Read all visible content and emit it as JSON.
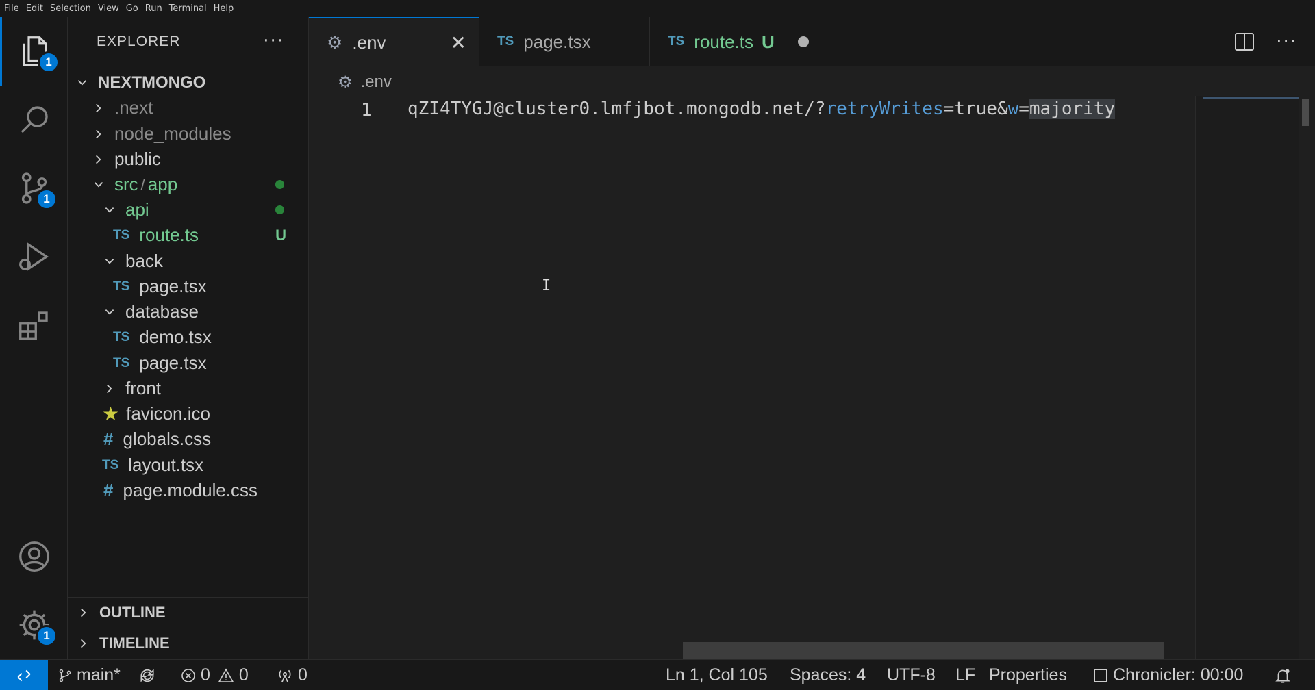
{
  "menu": [
    "File",
    "Edit",
    "Selection",
    "View",
    "Go",
    "Run",
    "Terminal",
    "Help"
  ],
  "activity": {
    "explorer_badge": "1",
    "scm_badge": "1",
    "settings_badge": "1"
  },
  "sidebar": {
    "title": "EXPLORER",
    "more": "···",
    "root": "NEXTMONGO",
    "tree": {
      "next": ".next",
      "node_modules": "node_modules",
      "public": "public",
      "src": "src",
      "sep": "/",
      "app": "app",
      "api": "api",
      "route": "route.ts",
      "route_status": "U",
      "back": "back",
      "back_page": "page.tsx",
      "database": "database",
      "demo": "demo.tsx",
      "db_page": "page.tsx",
      "front": "front",
      "favicon": "favicon.ico",
      "globals": "globals.css",
      "layout": "layout.tsx",
      "page_module": "page.module.css"
    },
    "ts_label": "TS",
    "hash_label": "#",
    "outline": "OUTLINE",
    "timeline": "TIMELINE"
  },
  "tabs": [
    {
      "label": ".env",
      "active": true
    },
    {
      "label": "page.tsx",
      "active": false
    },
    {
      "label": "route.ts",
      "status": "U",
      "active": false
    }
  ],
  "breadcrumb": ".env",
  "editor": {
    "line_number": "1",
    "code_a": "qZI4TYGJ@cluster0.lmfjbot.mongodb.net/?",
    "code_kw1": "retryWrites",
    "code_b": "=true&",
    "code_kw2": "w",
    "code_c": "=",
    "code_hl": "majority"
  },
  "status": {
    "branch": "main*",
    "errors": "0",
    "warnings": "0",
    "ports": "0",
    "position": "Ln 1, Col 105",
    "spaces": "Spaces: 4",
    "encoding": "UTF-8",
    "eol": "LF",
    "language": "Properties",
    "chronicler": "Chronicler: 00:00"
  },
  "colors": {
    "accent": "#0078d4",
    "untracked": "#73c991",
    "ts_icon": "#519aba"
  }
}
